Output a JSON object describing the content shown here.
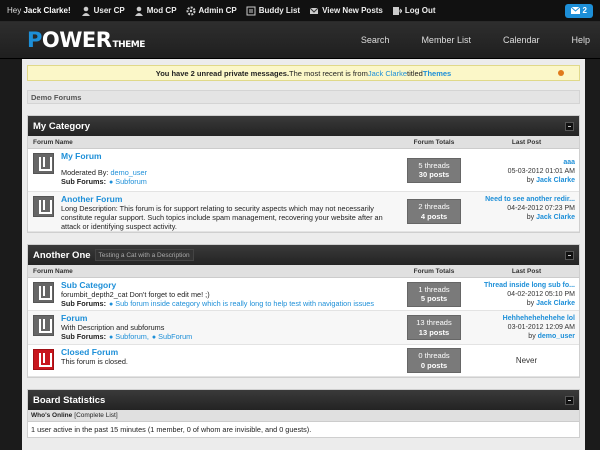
{
  "topbar": {
    "greeting": "Hey",
    "username": "Jack Clarke!",
    "links": [
      "User CP",
      "Mod CP",
      "Admin CP",
      "Buddy List",
      "View New Posts",
      "Log Out"
    ],
    "pm_count": "2"
  },
  "header": {
    "logo_power": "POWER",
    "logo_theme": "THEME",
    "nav": [
      "Search",
      "Member List",
      "Calendar",
      "Help"
    ]
  },
  "notice": {
    "prefix": "You have 2 unread private messages.",
    "middle": " The most recent is from ",
    "from": "Jack Clarke",
    "titled": " titled ",
    "title": "Themes"
  },
  "breadcrumb": "Demo Forums",
  "columns": {
    "forum": "Forum Name",
    "totals": "Forum Totals",
    "last": "Last Post"
  },
  "categories": [
    {
      "name": "My Category",
      "description": "",
      "forums": [
        {
          "name": "My Forum",
          "line1": "",
          "moderated_label": "Moderated By:",
          "moderator": "demo_user",
          "sub_label": "Sub Forums:",
          "subforums": [
            "Subforum"
          ],
          "threads": "5 threads",
          "posts": "30 posts",
          "last_title": "aaa",
          "last_date": "05-03-2012 01:01 AM",
          "last_by": "Jack Clarke",
          "icon": "gray"
        },
        {
          "name": "Another Forum",
          "line1": "Long Description: This forum is for support relating to security aspects which may not necessarily constitute regular support. Such topics include spam management, recovering your website after an attack or identifying suspect activity.",
          "threads": "2 threads",
          "posts": "4 posts",
          "last_title": "Need to see another redir...",
          "last_date": "04-24-2012 07:23 PM",
          "last_by": "Jack Clarke",
          "icon": "gray"
        }
      ]
    },
    {
      "name": "Another One",
      "description": "Testing a Cat with a Description",
      "forums": [
        {
          "name": "Sub Category",
          "line1": "forumbit_depth2_cat Don't forget to edit me! ;)",
          "sub_label": "Sub Forums:",
          "subforums": [
            "Sub forum inside category which is really long to help test with navigation issues"
          ],
          "threads": "1 threads",
          "posts": "5 posts",
          "last_title": "Thread inside long sub fo...",
          "last_date": "04-02-2012 05:10 PM",
          "last_by": "Jack Clarke",
          "icon": "gray"
        },
        {
          "name": "Forum",
          "line1": "With Description and subforums",
          "sub_label": "Sub Forums:",
          "subforums": [
            "Subforum,",
            "SubForum"
          ],
          "threads": "13 threads",
          "posts": "13 posts",
          "last_title": "Hehhehehehehehe lol",
          "last_date": "03-01-2012 12:09 AM",
          "last_by": "demo_user",
          "icon": "gray"
        },
        {
          "name": "Closed Forum",
          "line1": "This forum is closed.",
          "threads": "0 threads",
          "posts": "0 posts",
          "last_never": "Never",
          "icon": "red"
        }
      ]
    }
  ],
  "stats": {
    "title": "Board Statistics",
    "whos_online": "Who's Online",
    "complete_list": "[Complete List]",
    "online_line": "1 user active in the past 15 minutes (1 member, 0 of whom are invisible, and 0 guests)."
  }
}
